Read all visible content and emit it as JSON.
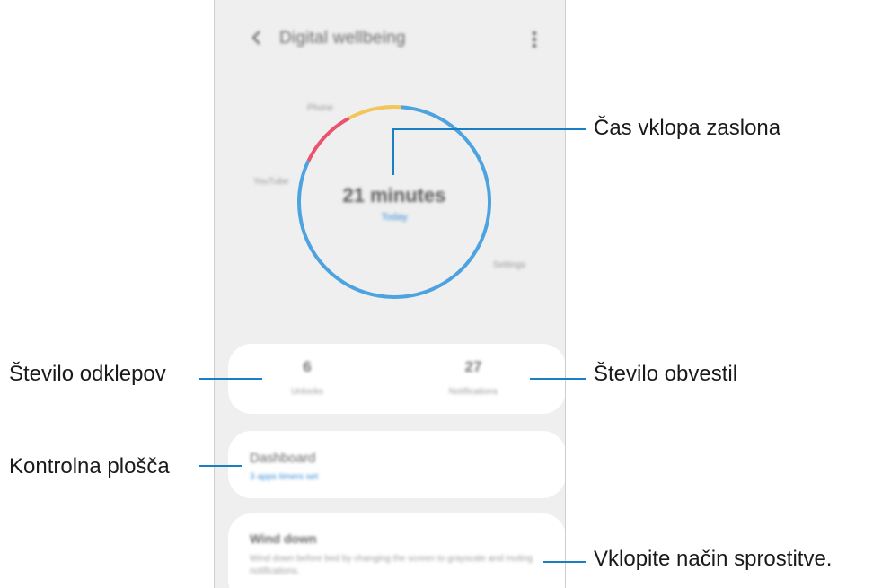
{
  "app": {
    "title": "Digital wellbeing"
  },
  "usage_chart": {
    "total_label": "21 minutes",
    "period_label": "Today",
    "segment_labels": [
      "Phone",
      "YouTube",
      "Settings"
    ],
    "segments": [
      {
        "app": "Phone",
        "fraction": 0.09,
        "color": "#f2c65a"
      },
      {
        "app": "YouTube",
        "fraction": 0.1,
        "color": "#e9536d"
      },
      {
        "app": "Settings",
        "fraction": 0.81,
        "color": "#4da3e0"
      }
    ]
  },
  "stats": {
    "unlocks_value": "6",
    "unlocks_label": "Unlocks",
    "notifications_value": "27",
    "notifications_label": "Notifications"
  },
  "dashboard": {
    "title": "Dashboard",
    "subtitle": "3 apps timers set"
  },
  "wind_down": {
    "title": "Wind down",
    "description": "Wind down before bed by changing the screen to grayscale and muting notifications."
  },
  "callouts": {
    "screen_time": "Čas vklopa zaslona",
    "notifications": "Število obvestil",
    "unlocks": "Število odklepov",
    "dashboard": "Kontrolna plošča",
    "wind_down": "Vklopite način sprostitve."
  },
  "colors": {
    "accent": "#1a7fc4",
    "link_blue": "#3e8fd9"
  }
}
